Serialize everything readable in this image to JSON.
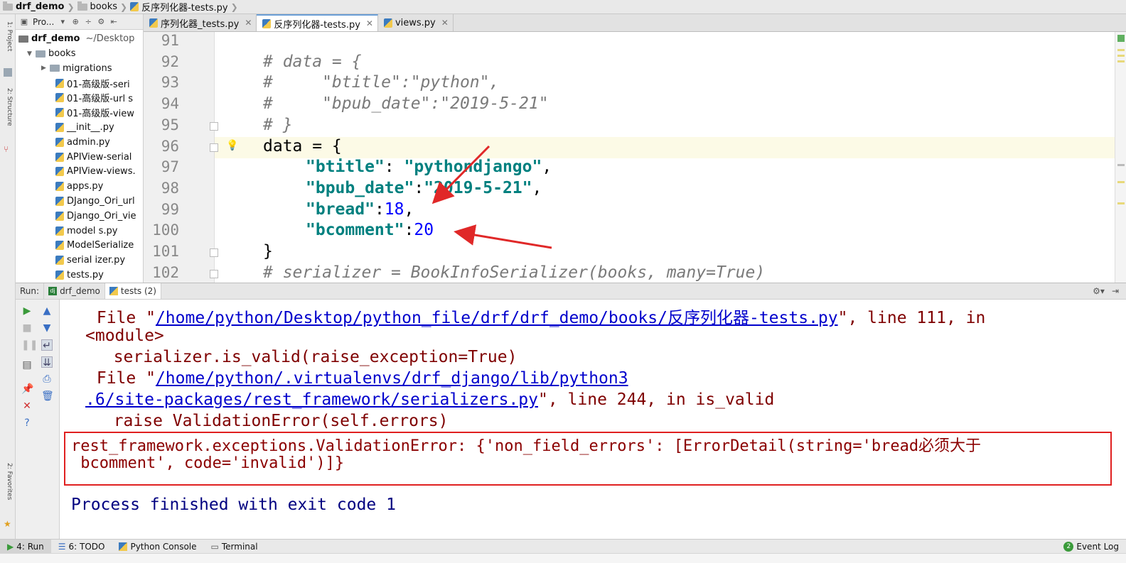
{
  "breadcrumb": [
    "drf_demo",
    "books",
    "反序列化器-tests.py"
  ],
  "left_strip_labels": [
    "1: Project",
    "2: Structure",
    "2: Favorites"
  ],
  "project": {
    "toolbar_label": "Pro...",
    "root_name": "drf_demo",
    "root_path": "~/Desktop",
    "items": [
      {
        "name": "books",
        "type": "folder",
        "depth": 1
      },
      {
        "name": "migrations",
        "type": "folder",
        "depth": 2
      },
      {
        "name": "01-高级版-seri",
        "type": "file",
        "depth": 2
      },
      {
        "name": "01-高级版-url s",
        "type": "file",
        "depth": 2
      },
      {
        "name": "01-高级版-view",
        "type": "file",
        "depth": 2
      },
      {
        "name": "__init__.py",
        "type": "file",
        "depth": 2
      },
      {
        "name": "admin.py",
        "type": "file",
        "depth": 2
      },
      {
        "name": "APIView-serial",
        "type": "file",
        "depth": 2
      },
      {
        "name": "APIView-views.",
        "type": "file",
        "depth": 2
      },
      {
        "name": "apps.py",
        "type": "file",
        "depth": 2
      },
      {
        "name": "DJango_Ori_url",
        "type": "file",
        "depth": 2
      },
      {
        "name": "Django_Ori_vie",
        "type": "file",
        "depth": 2
      },
      {
        "name": "model s.py",
        "type": "file",
        "depth": 2
      },
      {
        "name": "ModelSerialize",
        "type": "file",
        "depth": 2
      },
      {
        "name": "serial izer.py",
        "type": "file",
        "depth": 2
      },
      {
        "name": "tests.py",
        "type": "file",
        "depth": 2
      }
    ]
  },
  "editor_tabs": [
    {
      "label": "序列化器_tests.py",
      "active": false
    },
    {
      "label": "反序列化器-tests.py",
      "active": true
    },
    {
      "label": "views.py",
      "active": false
    }
  ],
  "code": {
    "lines": [
      {
        "n": "91"
      },
      {
        "n": "92",
        "t": "# data = {"
      },
      {
        "n": "93",
        "t": "#     \"btitle\":\"python\","
      },
      {
        "n": "94",
        "t": "#     \"bpub_date\":\"2019-5-21\""
      },
      {
        "n": "95",
        "t": "# }"
      },
      {
        "n": "96",
        "a": "data = {"
      },
      {
        "n": "97",
        "s": "\"btitle\"",
        "p": ": ",
        "s2": "\"pythondjango\"",
        "e": ","
      },
      {
        "n": "98",
        "s": "\"bpub_date\"",
        "p": ":",
        "s2": "\"2019-5-21\"",
        "e": ","
      },
      {
        "n": "99",
        "s": "\"bread\"",
        "p": ":",
        "v": "18",
        "e": ","
      },
      {
        "n": "100",
        "s": "\"bcomment\"",
        "p": ":",
        "v": "20"
      },
      {
        "n": "101",
        "a": "}"
      },
      {
        "n": "102",
        "t": "# serializer = BookInfoSerializer(books, many=True)"
      }
    ]
  },
  "run": {
    "label": "Run:",
    "tabs": [
      "drf_demo",
      "tests (2)"
    ],
    "console": {
      "l1_pre": " File \"",
      "l1_link": "/home/python/Desktop/python_file/drf/drf_demo/books/反序列化器-tests.py",
      "l1_post": "\", line 111, in",
      "l2": "<module>",
      "l3": "  serializer.is_valid(raise_exception=True)",
      "l4_pre": " File \"",
      "l4_link": "/home/python/.virtualenvs/drf_django/lib/python3",
      "l5_link": ".6/site-packages/rest_framework/serializers.py",
      "l5_post": "\", line 244, in is_valid",
      "l6": "  raise ValidationError(self.errors)",
      "err1": "rest_framework.exceptions.ValidationError: {'non_field_errors': [ErrorDetail(string='bread必须大于",
      "err2": " bcomment', code='invalid')]}",
      "exit": "Process finished with exit code 1"
    }
  },
  "bottom_bar": {
    "run": "4: Run",
    "todo": "6: TODO",
    "python_console": "Python Console",
    "terminal": "Terminal",
    "event_log": "Event Log",
    "event_count": "2"
  },
  "colors": {
    "accent": "#6b9ed6",
    "error_box": "#e02020",
    "arrow": "#e02828",
    "string": "#00807f",
    "number": "#0000ff",
    "comment": "#7a7a7a",
    "link": "#0000cc",
    "traceback": "#7f0000"
  }
}
